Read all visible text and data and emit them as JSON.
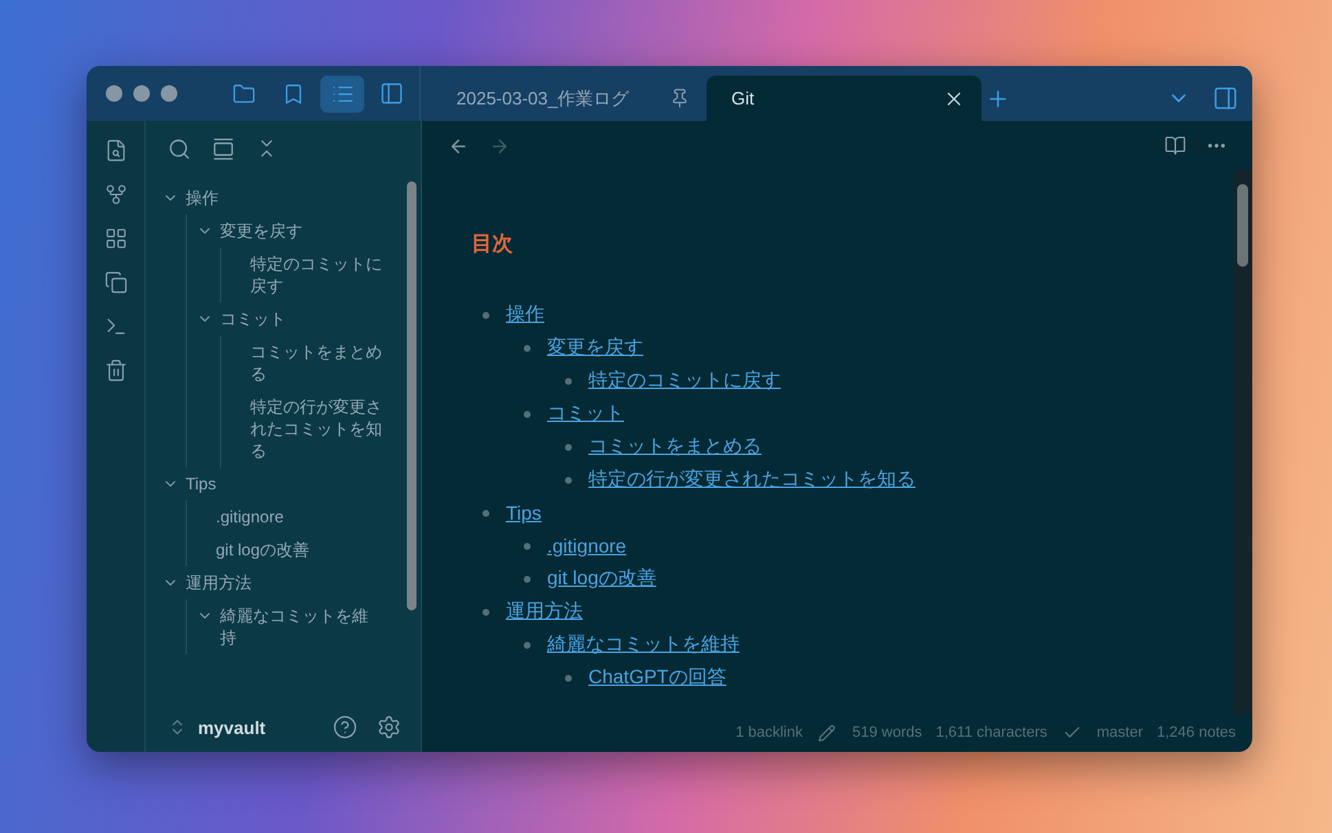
{
  "sidebar_views": [
    {
      "kind": "files",
      "selected": false
    },
    {
      "kind": "bookmarks",
      "selected": false
    },
    {
      "kind": "outline",
      "selected": true
    }
  ],
  "tabs": [
    {
      "title": "2025-03-03_作業ログ",
      "selected": false,
      "pinned": true
    },
    {
      "title": "Git",
      "selected": true,
      "pinned": false
    }
  ],
  "navigation": {
    "back_disabled": false,
    "forward_disabled": true
  },
  "outline": [
    {
      "label": "操作",
      "expanded": true,
      "children": [
        {
          "label": "変更を戻す",
          "expanded": true,
          "children": [
            {
              "label": "特定のコミットに戻す"
            }
          ]
        },
        {
          "label": "コミット",
          "expanded": true,
          "children": [
            {
              "label": "コミットをまとめる"
            },
            {
              "label": "特定の行が変更されたコミットを知る"
            }
          ]
        }
      ]
    },
    {
      "label": "Tips",
      "expanded": true,
      "children": [
        {
          "label": ".gitignore"
        },
        {
          "label": "git logの改善"
        }
      ]
    },
    {
      "label": "運用方法",
      "expanded": true,
      "children": [
        {
          "label": "綺麗なコミットを維持",
          "expanded": true
        }
      ]
    }
  ],
  "vault": {
    "name": "myvault"
  },
  "note": {
    "heading": "目次",
    "toc": [
      {
        "label": "操作",
        "children": [
          {
            "label": "変更を戻す",
            "children": [
              {
                "label": "特定のコミットに戻す"
              }
            ]
          },
          {
            "label": "コミット",
            "children": [
              {
                "label": "コミットをまとめる"
              },
              {
                "label": "特定の行が変更されたコミットを知る"
              }
            ]
          }
        ]
      },
      {
        "label": "Tips",
        "children": [
          {
            "label": ".gitignore"
          },
          {
            "label": "git logの改善"
          }
        ]
      },
      {
        "label": "運用方法",
        "children": [
          {
            "label": "綺麗なコミットを維持",
            "children": [
              {
                "label": "ChatGPTの回答"
              }
            ]
          }
        ]
      }
    ]
  },
  "status_bar": {
    "backlinks": "1 backlink",
    "words": "519 words",
    "characters": "1,611 characters",
    "branch": "master",
    "notes": "1,246 notes"
  }
}
